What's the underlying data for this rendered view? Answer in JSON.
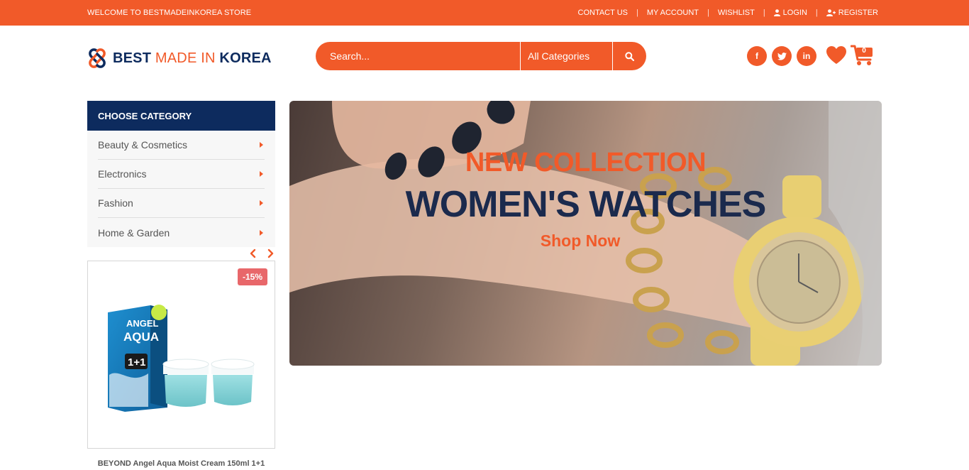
{
  "topbar": {
    "welcome": "WELCOME TO BESTMADEINKOREA STORE",
    "links": {
      "contact": "CONTACT US",
      "account": "MY ACCOUNT",
      "wishlist": "WISHLIST",
      "login": "LOGIN",
      "register": "REGISTER"
    }
  },
  "logo": {
    "word1": "BEST",
    "word2": "MADE IN",
    "word3": "KOREA"
  },
  "search": {
    "placeholder": "Search...",
    "category": "All Categories",
    "icon": "search-icon"
  },
  "social": {
    "facebook": "f",
    "linkedin": "in"
  },
  "cart": {
    "count": "0"
  },
  "sidebar": {
    "title": "CHOOSE CATEGORY",
    "items": [
      {
        "label": "Beauty & Cosmetics"
      },
      {
        "label": "Electronics"
      },
      {
        "label": "Fashion"
      },
      {
        "label": "Home & Garden"
      }
    ]
  },
  "product": {
    "badge": "-15%",
    "title": "BEYOND Angel Aqua Moist Cream 150ml 1+1",
    "box_text1": "ANGEL",
    "box_text2": "AQUA",
    "box_text3": "1+1"
  },
  "banner": {
    "line1": "NEW COLLECTION",
    "line2": "WOMEN'S WATCHES",
    "cta": "Shop Now"
  },
  "colors": {
    "accent": "#f15a29",
    "navy": "#0d2b5e",
    "badge": "#e8676a"
  }
}
